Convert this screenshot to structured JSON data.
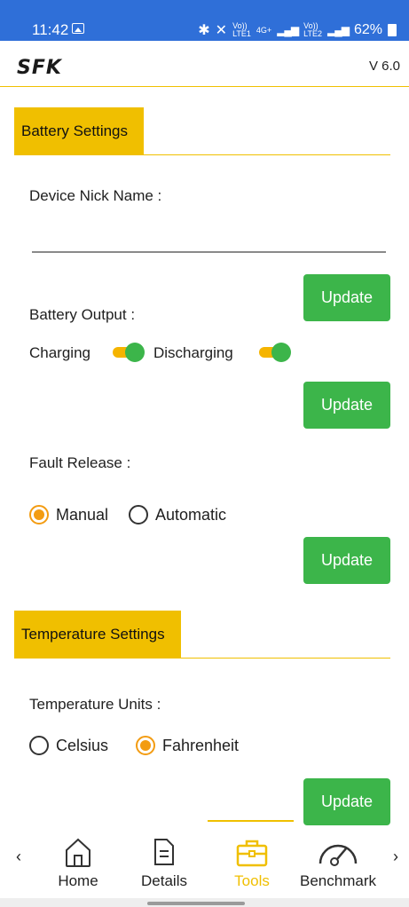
{
  "status_bar": {
    "time": "11:42",
    "network_small_1": "Vo))",
    "network_small_2": "LTE1",
    "network_4g": "4G+",
    "network_small_3": "Vo))",
    "network_small_4": "LTE2",
    "battery_percent": "62%"
  },
  "app_bar": {
    "logo_text": "SFK",
    "version": "V 6.0"
  },
  "battery_settings": {
    "header": "Battery Settings",
    "nick_name_label": "Device Nick Name :",
    "nick_name_value": "",
    "update_label": "Update",
    "output_label": "Battery Output :",
    "charging_label": "Charging",
    "charging_on": true,
    "discharging_label": "Discharging",
    "discharging_on": true,
    "fault_release_label": "Fault Release :",
    "manual_label": "Manual",
    "automatic_label": "Automatic",
    "fault_release_selected": "Manual"
  },
  "temperature_settings": {
    "header": "Temperature Settings",
    "units_label": "Temperature Units :",
    "celsius_label": "Celsius",
    "fahrenheit_label": "Fahrenheit",
    "selected_unit": "Fahrenheit",
    "update_label": "Update"
  },
  "bottom_nav": {
    "items": [
      {
        "label": "Home",
        "icon": "home-icon"
      },
      {
        "label": "Details",
        "icon": "document-icon"
      },
      {
        "label": "Tools",
        "icon": "toolbox-icon"
      },
      {
        "label": "Benchmark",
        "icon": "gauge-icon"
      }
    ],
    "active": "Tools"
  },
  "colors": {
    "accent_yellow": "#f0bf00",
    "button_green": "#3cb54a",
    "radio_orange": "#f39c12",
    "status_blue": "#2f6fd8"
  }
}
